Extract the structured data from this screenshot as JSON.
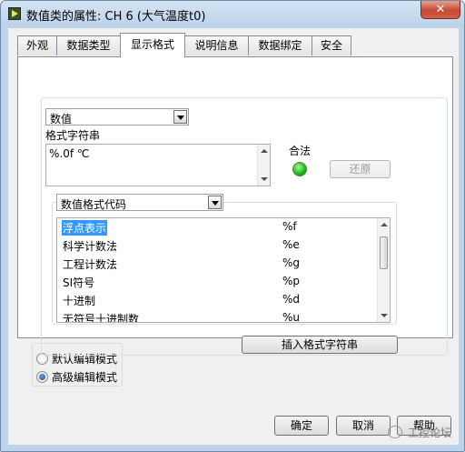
{
  "window": {
    "title": "数值类的属性: CH 6 (大气温度t0)",
    "close_glyph": "✕"
  },
  "tabs": [
    {
      "label": "外观"
    },
    {
      "label": "数据类型"
    },
    {
      "label": "显示格式",
      "active": true
    },
    {
      "label": "说明信息"
    },
    {
      "label": "数据绑定"
    },
    {
      "label": "安全"
    }
  ],
  "format_panel": {
    "type_select": "数值",
    "format_string_label": "格式字符串",
    "format_string_value": "%.0f ℃",
    "valid_label": "合法",
    "valid_led_color": "#22c01c",
    "revert_button": "还原",
    "code_select": "数值格式代码",
    "codes": [
      {
        "name": "浮点表示",
        "code": "%f"
      },
      {
        "name": "科学计数法",
        "code": "%e"
      },
      {
        "name": "工程计数法",
        "code": "%g"
      },
      {
        "name": "SI符号",
        "code": "%p"
      },
      {
        "name": "十进制",
        "code": "%d"
      },
      {
        "name": "无符号十进制数",
        "code": "%u"
      }
    ],
    "insert_button": "插入格式字符串"
  },
  "edit_mode": {
    "default_label": "默认编辑模式",
    "advanced_label": "高级编辑模式",
    "selected": "advanced"
  },
  "footer": {
    "ok": "确定",
    "cancel": "取消",
    "help": "帮助"
  },
  "watermark": "工控论坛",
  "colors": {
    "selection": "#3399ff",
    "titlebar": "#bcd3ea",
    "close_button": "#c64a35"
  }
}
